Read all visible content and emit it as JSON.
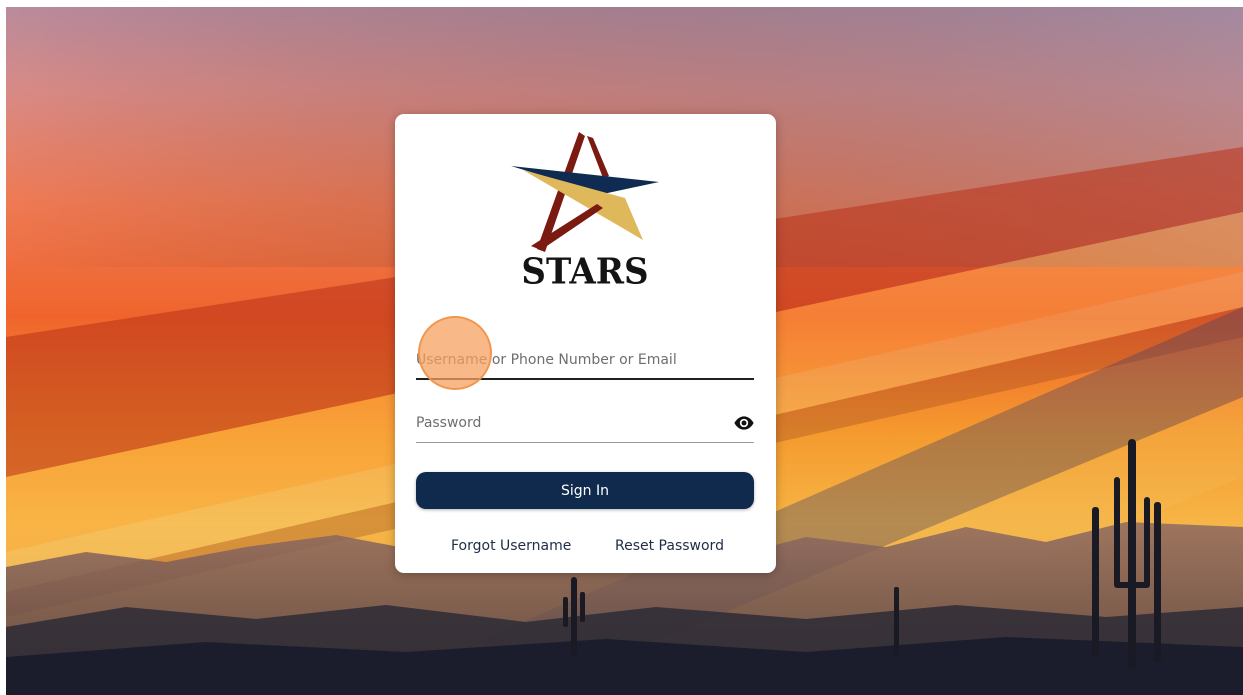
{
  "brand": {
    "name": "STARS",
    "colors": {
      "navy": "#0f2a4d",
      "maroon": "#7a1a10",
      "gold": "#e1b95a"
    }
  },
  "login": {
    "username_placeholder": "Username or Phone Number or Email",
    "username_value": "",
    "password_placeholder": "Password",
    "password_value": "",
    "password_toggle_icon": "eye-icon",
    "sign_in_label": "Sign In",
    "forgot_username_label": "Forgot Username",
    "reset_password_label": "Reset Password"
  },
  "colors": {
    "button_bg": "#0f2a4d",
    "button_text": "#ffffff",
    "link_text": "#1e2e45"
  }
}
